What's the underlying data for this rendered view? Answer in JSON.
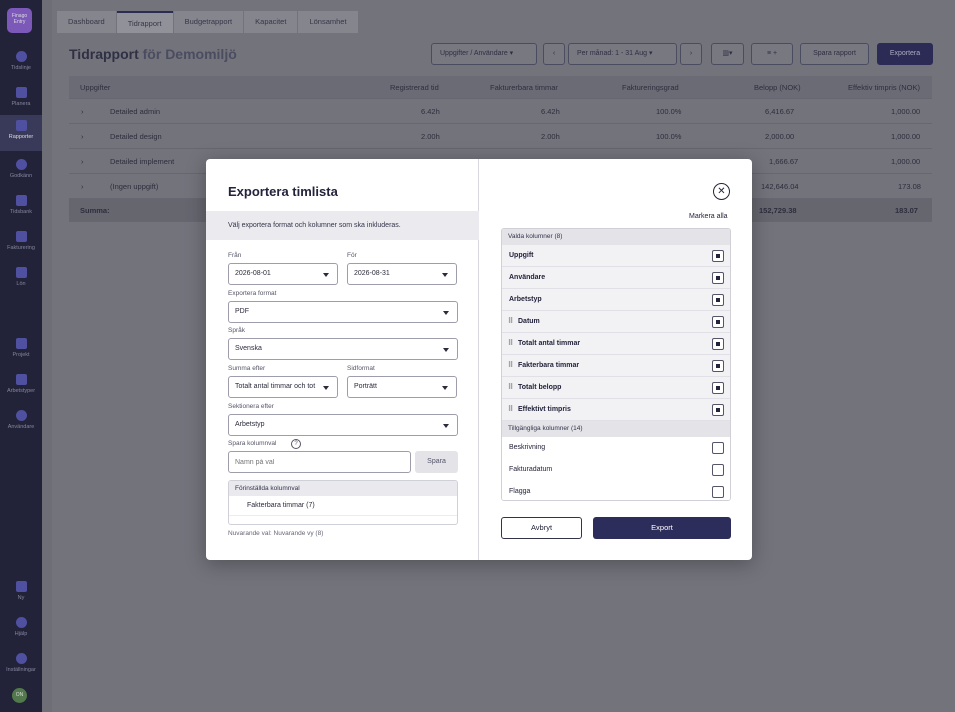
{
  "sidebar": {
    "logo": "Finago Entry",
    "items": [
      {
        "label": "Tidslinje"
      },
      {
        "label": "Planera"
      },
      {
        "label": "Rapporter"
      },
      {
        "label": "Godkänn"
      },
      {
        "label": "Tidsbank"
      },
      {
        "label": "Fakturering"
      },
      {
        "label": "Lön"
      },
      {
        "label": "Projekt"
      },
      {
        "label": "Arbetstyper"
      },
      {
        "label": "Användare"
      },
      {
        "label": "Ny"
      },
      {
        "label": "Hjälp"
      },
      {
        "label": "Inställningar"
      }
    ],
    "avatar": "ON"
  },
  "tabs": [
    "Dashboard",
    "Tidrapport",
    "Budgetrapport",
    "Kapacitet",
    "Lönsamhet"
  ],
  "header": {
    "title": "Tidrapport",
    "subtitle": "för Demomiljö",
    "group_select": "Uppgifter / Användare",
    "period": "Per månad: 1 - 31 Aug",
    "save_report": "Spara rapport",
    "export": "Exportera"
  },
  "grid": {
    "headers": [
      "Uppgifter",
      "Registrerad tid",
      "Fakturerbara timmar",
      "Faktureringsgrad",
      "Belopp (NOK)",
      "Effektiv timpris (NOK)"
    ],
    "rows": [
      {
        "name": "Detailed admin",
        "reg": "6.42h",
        "fak": "6.42h",
        "grad": "100.0%",
        "belopp": "6,416.67",
        "timpris": "1,000.00"
      },
      {
        "name": "Detailed design",
        "reg": "2.00h",
        "fak": "2.00h",
        "grad": "100.0%",
        "belopp": "2,000.00",
        "timpris": "1,000.00"
      },
      {
        "name": "Detailed implement",
        "reg": "",
        "fak": "",
        "grad": "",
        "belopp": "1,666.67",
        "timpris": "1,000.00"
      },
      {
        "name": "(Ingen uppgift)",
        "reg": "",
        "fak": "",
        "grad": "",
        "belopp": "142,646.04",
        "timpris": "173.08"
      }
    ],
    "sum": {
      "label": "Summa:",
      "belopp": "152,729.38",
      "timpris": "183.07"
    }
  },
  "modal": {
    "title": "Exportera timlista",
    "description": "Välj exportera format och kolumner som ska inkluderas.",
    "from_label": "Från",
    "from_value": "2026-08-01",
    "to_label": "För",
    "to_value": "2026-08-31",
    "format_label": "Exportera format",
    "format_value": "PDF",
    "language_label": "Språk",
    "language_value": "Svenska",
    "sum_label": "Summa efter",
    "sum_value": "Totalt antal timmar och tot",
    "page_label": "Sidformat",
    "page_value": "Porträtt",
    "section_label": "Sektionera efter",
    "section_value": "Arbetstyp",
    "save_cols_label": "Spara kolumnval",
    "save_cols_placeholder": "Namn på val",
    "save_button": "Spara",
    "preset_head": "Förinställda kolumnval",
    "preset_items": [
      "Fakterbara timmar (7)"
    ],
    "current_choice": "Nuvarande val: Nuvarande vy (8)",
    "mark_all": "Markera alla",
    "selected_head": "Valda kolumner (8)",
    "selected_columns": [
      {
        "label": "Uppgift",
        "draggable": false
      },
      {
        "label": "Användare",
        "draggable": false
      },
      {
        "label": "Arbetstyp",
        "draggable": false
      },
      {
        "label": "Datum",
        "draggable": true
      },
      {
        "label": "Totalt antal timmar",
        "draggable": true
      },
      {
        "label": "Fakterbara timmar",
        "draggable": true
      },
      {
        "label": "Totalt belopp",
        "draggable": true
      },
      {
        "label": "Effektivt timpris",
        "draggable": true
      }
    ],
    "available_head": "Tillgängliga kolumner (14)",
    "available_columns": [
      "Beskrivning",
      "Fakturadatum",
      "Flagga"
    ],
    "cancel": "Avbryt",
    "export": "Export"
  }
}
